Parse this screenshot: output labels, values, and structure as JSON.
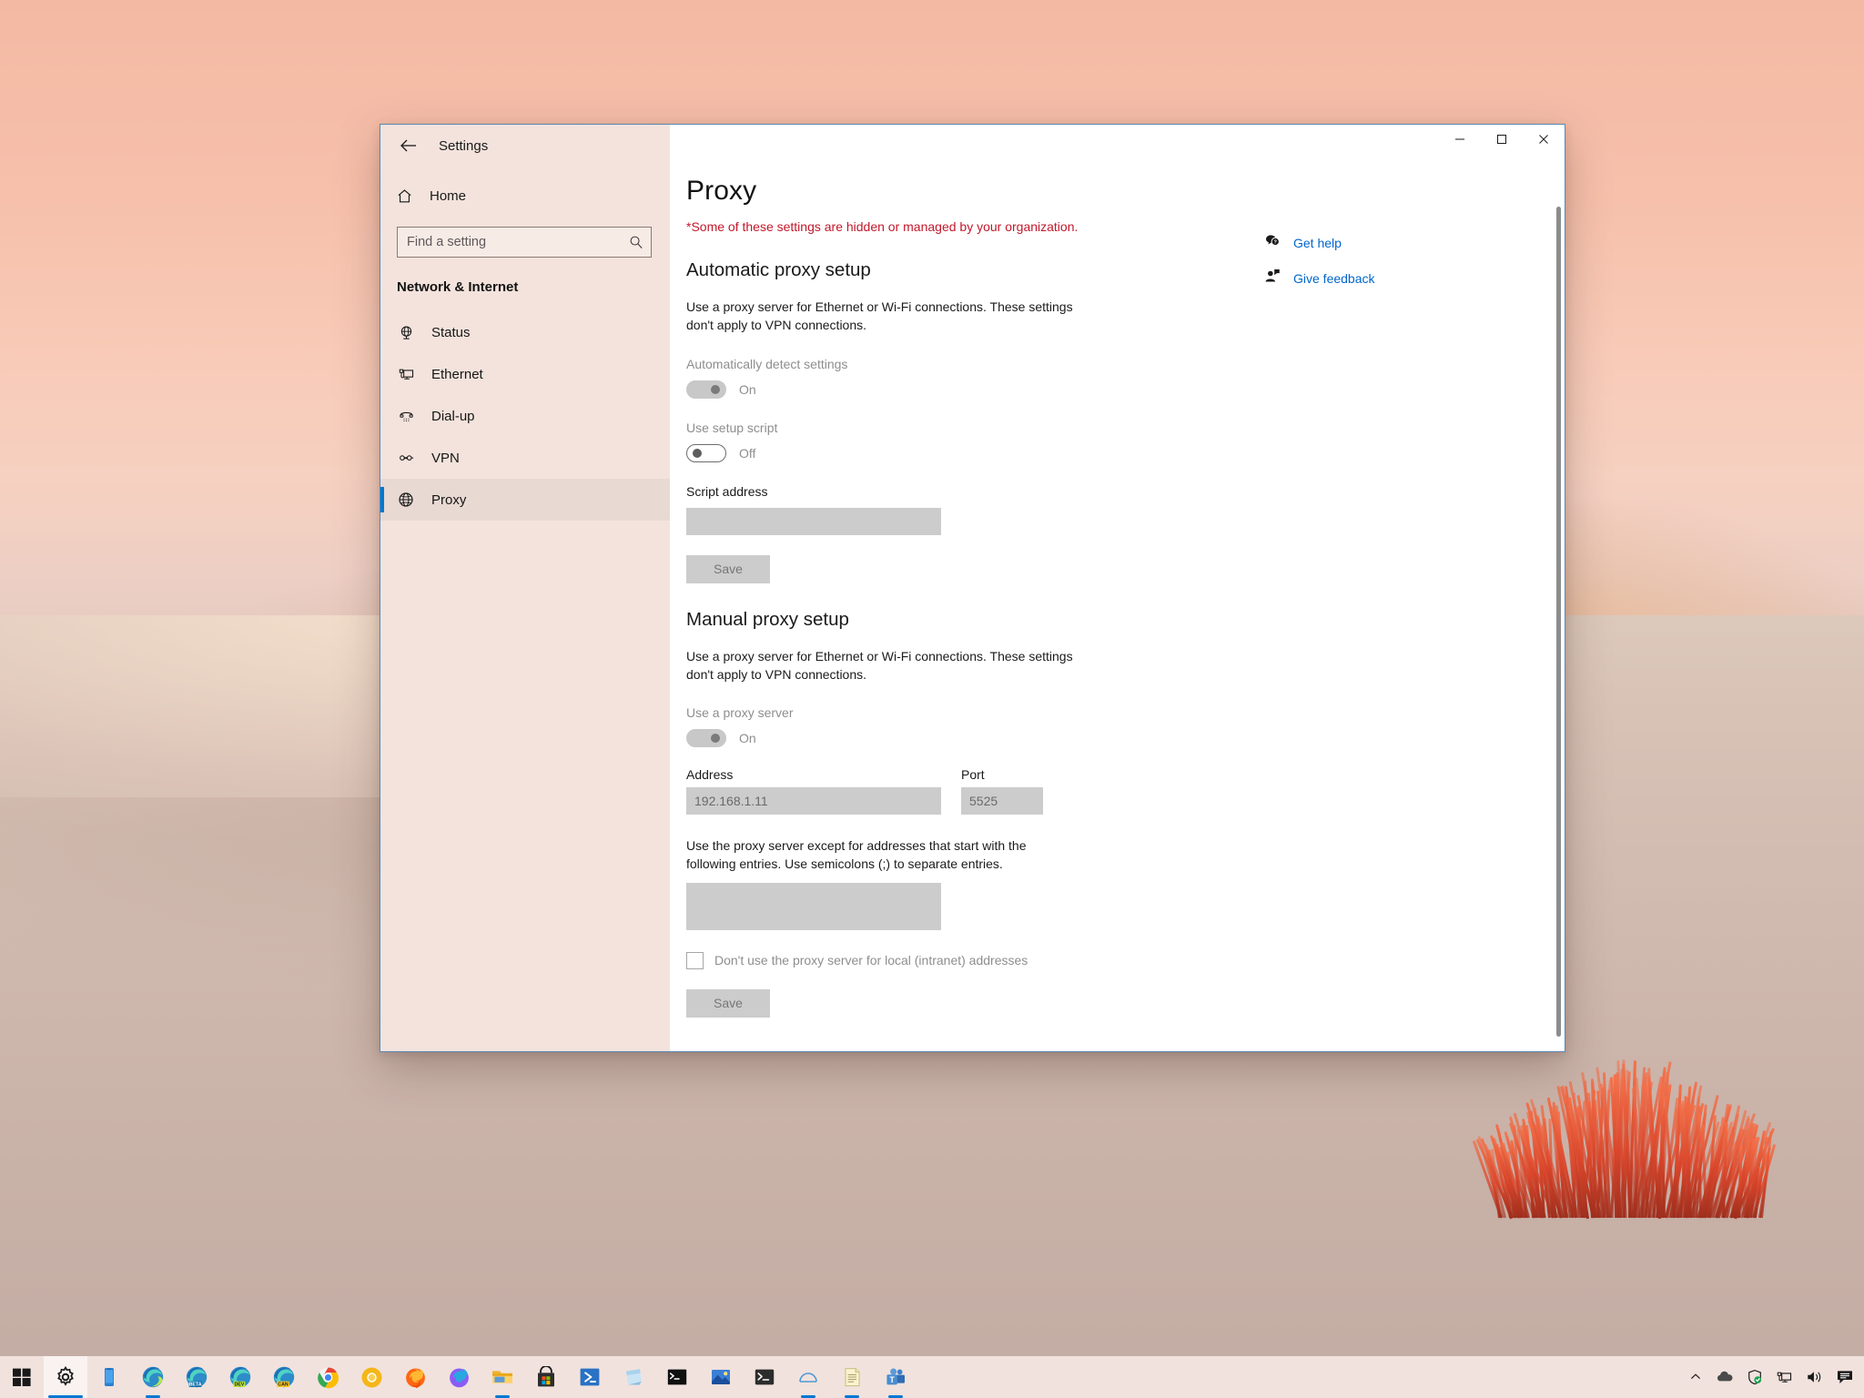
{
  "window": {
    "app_title": "Settings",
    "back_icon": "arrow-left-icon",
    "minimize_label": "Minimize",
    "maximize_label": "Maximize",
    "close_label": "Close"
  },
  "sidebar": {
    "home_label": "Home",
    "home_icon": "home-icon",
    "search": {
      "placeholder": "Find a setting",
      "value": "",
      "icon": "search-icon"
    },
    "category": "Network & Internet",
    "items": [
      {
        "label": "Status",
        "icon": "globe-status-icon",
        "selected": false
      },
      {
        "label": "Ethernet",
        "icon": "ethernet-icon",
        "selected": false
      },
      {
        "label": "Dial-up",
        "icon": "dialup-phone-icon",
        "selected": false
      },
      {
        "label": "VPN",
        "icon": "vpn-icon",
        "selected": false
      },
      {
        "label": "Proxy",
        "icon": "globe-proxy-icon",
        "selected": true
      }
    ]
  },
  "main": {
    "page_title": "Proxy",
    "managed_note": "*Some of these settings are hidden or managed by your organization.",
    "automatic": {
      "heading": "Automatic proxy setup",
      "description": "Use a proxy server for Ethernet or Wi-Fi connections. These settings don't apply to VPN connections.",
      "auto_detect_label": "Automatically detect settings",
      "auto_detect_state": "On",
      "use_script_label": "Use setup script",
      "use_script_state": "Off",
      "script_address_label": "Script address",
      "script_address_value": "",
      "save_label": "Save"
    },
    "manual": {
      "heading": "Manual proxy setup",
      "description": "Use a proxy server for Ethernet or Wi-Fi connections. These settings don't apply to VPN connections.",
      "use_proxy_label": "Use a proxy server",
      "use_proxy_state": "On",
      "address_label": "Address",
      "address_value": "192.168.1.11",
      "port_label": "Port",
      "port_value": "5525",
      "exceptions_description": "Use the proxy server except for addresses that start with the following entries. Use semicolons (;) to separate entries.",
      "exceptions_value": "",
      "local_bypass_label": "Don't use the proxy server for local (intranet) addresses",
      "local_bypass_checked": false,
      "save_label": "Save"
    }
  },
  "aside": {
    "links": [
      {
        "label": "Get help",
        "icon": "help-chat-icon"
      },
      {
        "label": "Give feedback",
        "icon": "feedback-person-icon"
      }
    ]
  },
  "taskbar": {
    "start_icon": "windows-start-icon",
    "items": [
      {
        "name": "settings-taskbar",
        "icon": "gear-icon",
        "state": "active"
      },
      {
        "name": "your-phone-taskbar",
        "icon": "phone-icon",
        "state": "idle"
      },
      {
        "name": "edge-taskbar",
        "icon": "edge-icon",
        "state": "open"
      },
      {
        "name": "edge-beta-taskbar",
        "icon": "edge-beta-icon",
        "state": "idle"
      },
      {
        "name": "edge-dev-taskbar",
        "icon": "edge-dev-icon",
        "state": "idle"
      },
      {
        "name": "edge-canary-taskbar",
        "icon": "edge-canary-icon",
        "state": "idle"
      },
      {
        "name": "chrome-taskbar",
        "icon": "chrome-icon",
        "state": "idle"
      },
      {
        "name": "chrome-canary-taskbar",
        "icon": "chrome-canary-icon",
        "state": "idle"
      },
      {
        "name": "firefox-taskbar",
        "icon": "firefox-icon",
        "state": "idle"
      },
      {
        "name": "firefox-dev-taskbar",
        "icon": "firefox-dev-icon",
        "state": "idle"
      },
      {
        "name": "file-explorer-taskbar",
        "icon": "folder-icon",
        "state": "open"
      },
      {
        "name": "microsoft-store-taskbar",
        "icon": "store-bag-icon",
        "state": "idle"
      },
      {
        "name": "powershell-taskbar",
        "icon": "powershell-icon",
        "state": "idle"
      },
      {
        "name": "sticky-notes-taskbar",
        "icon": "sticky-note-icon",
        "state": "idle"
      },
      {
        "name": "command-prompt-taskbar",
        "icon": "command-prompt-icon",
        "state": "idle"
      },
      {
        "name": "photos-taskbar",
        "icon": "photos-icon",
        "state": "idle"
      },
      {
        "name": "windows-terminal-taskbar",
        "icon": "terminal-icon",
        "state": "idle"
      },
      {
        "name": "whiteboard-taskbar",
        "icon": "arc-icon",
        "state": "open"
      },
      {
        "name": "notepad-taskbar",
        "icon": "notepad-icon",
        "state": "open"
      },
      {
        "name": "teams-taskbar",
        "icon": "teams-icon",
        "state": "open"
      }
    ],
    "tray": [
      {
        "name": "show-hidden-icons",
        "icon": "chevron-up-icon"
      },
      {
        "name": "onedrive-tray",
        "icon": "cloud-icon"
      },
      {
        "name": "defender-tray",
        "icon": "shield-check-icon"
      },
      {
        "name": "network-tray",
        "icon": "ethernet-tray-icon"
      },
      {
        "name": "volume-tray",
        "icon": "speaker-icon"
      },
      {
        "name": "action-center",
        "icon": "action-center-icon"
      }
    ]
  },
  "colors": {
    "accent": "#0078d4",
    "error_text": "#c2182b",
    "link": "#0066cc",
    "window_border": "#5b87b0",
    "sidebar_bg": "#f3e3dc",
    "disabled_field": "#cccccc"
  }
}
